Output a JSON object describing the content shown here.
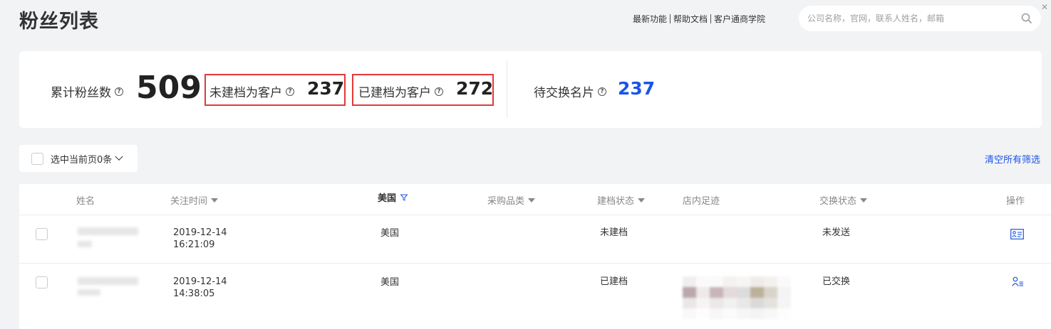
{
  "header": {
    "title": "粉丝列表",
    "links": [
      "最新功能",
      "帮助文档",
      "客户通商学院"
    ],
    "search_placeholder": "公司名称，官网，联系人姓名，邮箱",
    "close_glyph": "✕"
  },
  "stats": {
    "total_label": "累计粉丝数",
    "total_value": "509",
    "unfiled_label": "未建档为客户",
    "unfiled_value": "237",
    "filed_label": "已建档为客户",
    "filed_value": "272",
    "pending_label": "待交换名片",
    "pending_value": "237",
    "help_glyph": "?"
  },
  "toolbar": {
    "select_page_label": "选中当前页0条",
    "clear_filters_label": "清空所有筛选"
  },
  "table": {
    "columns": {
      "name": "姓名",
      "follow_time": "关注时间",
      "country": "美国",
      "category": "采购品类",
      "file_status": "建档状态",
      "footprint": "店内足迹",
      "exchange_status": "交换状态",
      "actions": "操作"
    },
    "rows": [
      {
        "date": "2019-12-14",
        "time": "16:21:09",
        "country": "美国",
        "file_status": "未建档",
        "exchange_status": "未发送",
        "action_icon": "contact-card-icon"
      },
      {
        "date": "2019-12-14",
        "time": "14:38:05",
        "country": "美国",
        "file_status": "已建档",
        "exchange_status": "已交换",
        "action_icon": "user-list-icon"
      }
    ]
  },
  "colors": {
    "accent_blue": "#1b54e8",
    "highlight_red": "#e23a3a",
    "background": "#f2f3f5"
  }
}
